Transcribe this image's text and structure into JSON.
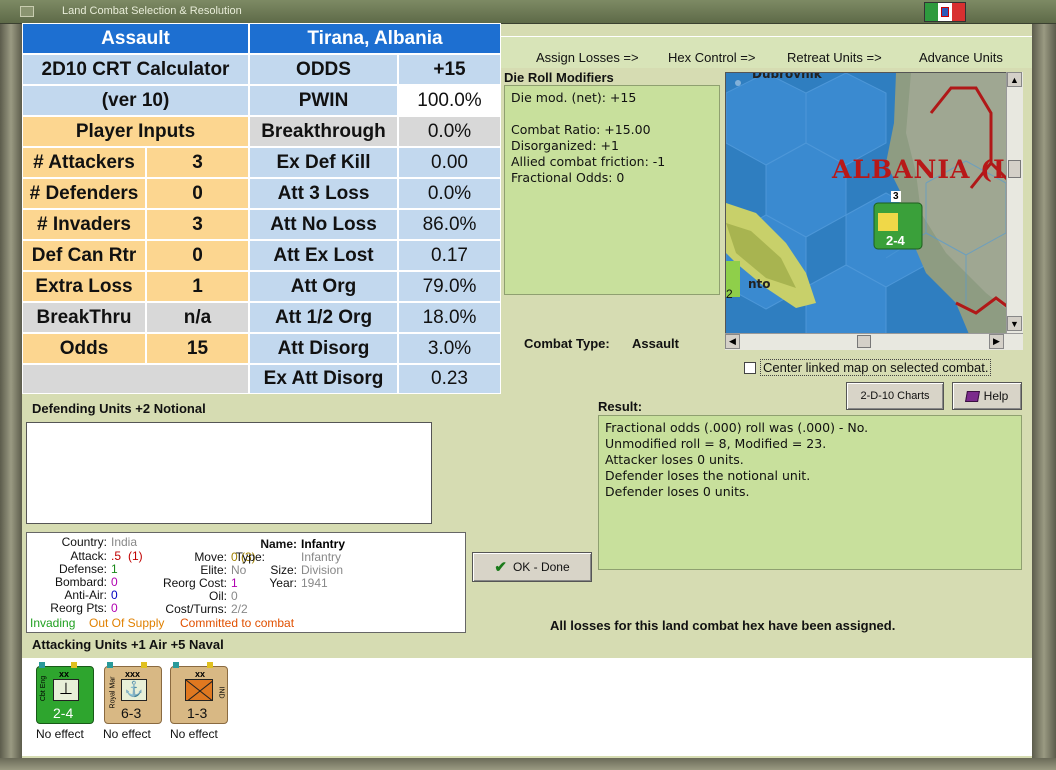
{
  "window": {
    "title": "Land Combat Selection & Resolution"
  },
  "nav": {
    "assign_losses": "Assign Losses =>",
    "hex_control": "Hex Control =>",
    "retreat_units": "Retreat Units =>",
    "advance_units": "Advance Units"
  },
  "crt": {
    "header_left": "Assault",
    "header_right": "Tirana, Albania",
    "calc_title_1": "2D10 CRT Calculator",
    "calc_title_2": "(ver 10)",
    "player_inputs": "Player Inputs",
    "inputs": [
      {
        "label": "# Attackers",
        "value": "3"
      },
      {
        "label": "# Defenders",
        "value": "0"
      },
      {
        "label": "# Invaders",
        "value": "3"
      },
      {
        "label": "Def Can Rtr",
        "value": "0"
      },
      {
        "label": "Extra Loss",
        "value": "1"
      },
      {
        "label": "BreakThru",
        "value": "n/a"
      },
      {
        "label": "Odds",
        "value": "15"
      }
    ],
    "outputs": [
      {
        "label": "ODDS",
        "value": "+15"
      },
      {
        "label": "PWIN",
        "value": "100.0%"
      },
      {
        "label": "Breakthrough",
        "value": "0.0%"
      },
      {
        "label": "Ex Def Kill",
        "value": "0.00"
      },
      {
        "label": "Att 3 Loss",
        "value": "0.0%"
      },
      {
        "label": "Att No Loss",
        "value": "86.0%"
      },
      {
        "label": "Att Ex Lost",
        "value": "0.17"
      },
      {
        "label": "Att Org",
        "value": "79.0%"
      },
      {
        "label": "Att 1/2 Org",
        "value": "18.0%"
      },
      {
        "label": "Att Disorg",
        "value": "3.0%"
      },
      {
        "label": "Ex Att Disorg",
        "value": "0.23"
      }
    ]
  },
  "die_roll": {
    "title": "Die Roll Modifiers",
    "lines": [
      "Die mod. (net): +15",
      "",
      "Combat Ratio: +15.00",
      "Disorganized: +1",
      "Allied combat friction: -1",
      "Fractional Odds: 0"
    ]
  },
  "map": {
    "label_country": "ALBANIA (I",
    "label_city": "Dubrovnik",
    "label_town": "nto",
    "unit_stack_count": "3",
    "unit_strength": "2-4",
    "edge_unit_strength": "2"
  },
  "combat_type": {
    "label": "Combat Type:",
    "value": "Assault"
  },
  "center_map": {
    "label": "Center linked map on selected combat."
  },
  "buttons": {
    "charts": "2-D-10 Charts",
    "help": "Help",
    "ok": "OK - Done"
  },
  "result": {
    "title": "Result:",
    "lines": [
      "Fractional odds (.000) roll was (.000)  - No.",
      "Unmodified roll = 8, Modified = 23.",
      "Attacker loses 0 units.",
      "Defender loses the notional unit.",
      "Defender loses 0 units."
    ]
  },
  "defending": {
    "title": "Defending Units +2 Notional"
  },
  "info": {
    "country_k": "Country:",
    "country_v": "India",
    "attack_k": "Attack:",
    "attack_v1": ".5",
    "attack_v2": "(1)",
    "defense_k": "Defense:",
    "defense_v": "1",
    "bombard_k": "Bombard:",
    "bombard_v": "0",
    "antiair_k": "Anti-Air:",
    "antiair_v": "0",
    "reorg_k": "Reorg Pts:",
    "reorg_v": "0",
    "name_k": "Name:",
    "name_v": "Infantry",
    "move_k": "Move:",
    "move_v": "0 (3)",
    "type_k": "Type:",
    "type_v": "Infantry",
    "elite_k": "Elite:",
    "elite_v": "No",
    "size_k": "Size:",
    "size_v": "Division",
    "reorgcost_k": "Reorg Cost:",
    "reorgcost_v": "1",
    "year_k": "Year:",
    "year_v": "1941",
    "oil_k": "Oil:",
    "oil_v": "0",
    "cost_k": "Cost/Turns:",
    "cost_v": "2/2",
    "status_invading": "Invading",
    "status_supply": "Out Of Supply",
    "status_committed": "Committed to combat"
  },
  "losses_message": "All losses for this land combat hex have been assigned.",
  "attacking": {
    "title": "Attacking Units +1 Air +5 Naval",
    "units": [
      {
        "side": "Cbt Eng",
        "size": "xx",
        "strength": "2-4",
        "status": "No effect"
      },
      {
        "side": "Royal Mar",
        "size": "xxx",
        "strength": "6-3",
        "status": "No effect"
      },
      {
        "side": "IND",
        "size": "xx",
        "strength": "1-3",
        "status": "No effect"
      }
    ]
  },
  "colors": {
    "crt_blue": "#1d6fd1",
    "panel_green": "#c8e09c",
    "attack_red": "#cc0000"
  }
}
